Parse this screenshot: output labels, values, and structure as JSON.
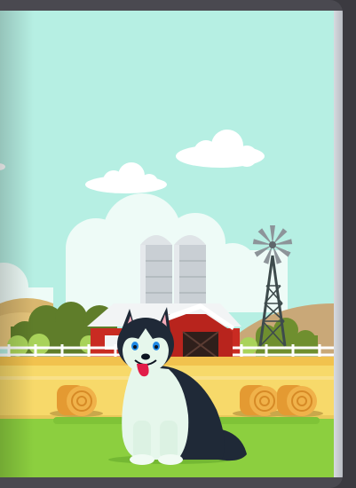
{
  "illustration": {
    "scene": "farm",
    "subject": "husky",
    "colors": {
      "sky": "#b6efe3",
      "cloud": "#ffffff",
      "grass": "#8ccf3f",
      "field": "#f7d96a",
      "barn": "#c92b22",
      "silo": "#c9cfd4",
      "hill": "#c9a878",
      "tree": "#5f7d2a"
    }
  },
  "icons": {
    "windmill": "windmill-icon",
    "hay_bale": "hay-bale-icon"
  }
}
